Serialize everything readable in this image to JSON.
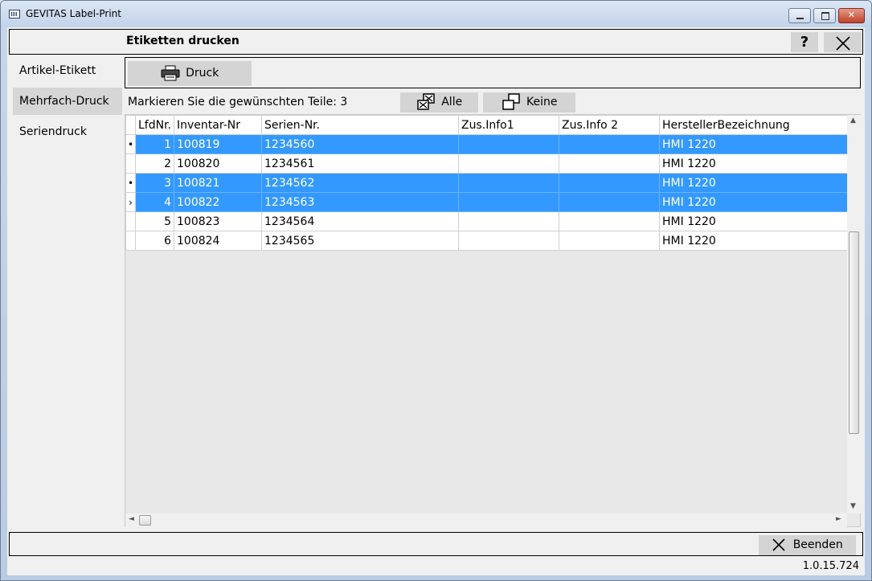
{
  "window": {
    "title": "GEVITAS Label-Print"
  },
  "header": {
    "title": "Etiketten drucken",
    "help_label": "?"
  },
  "sidebar": {
    "items": [
      {
        "label": "Artikel-Etikett",
        "active": false
      },
      {
        "label": "Mehrfach-Druck",
        "active": true
      },
      {
        "label": "Seriendruck",
        "active": false
      }
    ]
  },
  "toolbar": {
    "print_label": "Druck"
  },
  "selection": {
    "text": "Markieren Sie die gewünschten Teile: 3",
    "all_label": "Alle",
    "none_label": "Keine"
  },
  "grid": {
    "columns": [
      "LfdNr.",
      "Inventar-Nr",
      "Serien-Nr.",
      "Zus.Info1",
      "Zus.Info 2",
      "HerstellerBezeichnung"
    ],
    "rows": [
      {
        "indicator": "•",
        "selected": true,
        "cells": [
          "1",
          "100819",
          "1234560",
          "",
          "",
          "HMI 1220"
        ]
      },
      {
        "indicator": "",
        "selected": false,
        "cells": [
          "2",
          "100820",
          "1234561",
          "",
          "",
          "HMI 1220"
        ]
      },
      {
        "indicator": "•",
        "selected": true,
        "cells": [
          "3",
          "100821",
          "1234562",
          "",
          "",
          "HMI 1220"
        ]
      },
      {
        "indicator": "›",
        "selected": true,
        "cells": [
          "4",
          "100822",
          "1234563",
          "",
          "",
          "HMI 1220"
        ]
      },
      {
        "indicator": "",
        "selected": false,
        "cells": [
          "5",
          "100823",
          "1234564",
          "",
          "",
          "HMI 1220"
        ]
      },
      {
        "indicator": "",
        "selected": false,
        "cells": [
          "6",
          "100824",
          "1234565",
          "",
          "",
          "HMI 1220"
        ]
      }
    ]
  },
  "footer": {
    "exit_label": "Beenden",
    "version": "1.0.15.724"
  },
  "colors": {
    "selection": "#3399ff",
    "button": "#d4d4d4",
    "background": "#f0f0f0"
  }
}
